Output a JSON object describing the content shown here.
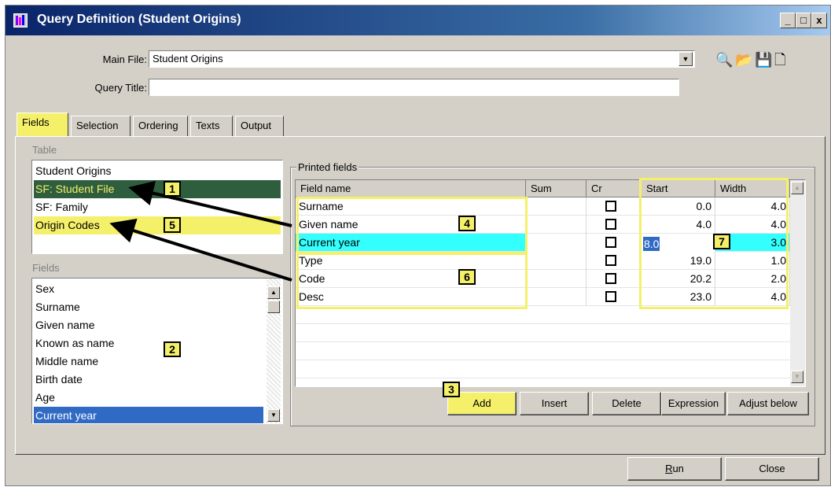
{
  "window": {
    "title": "Query Definition (Student Origins)",
    "minimize": "_",
    "maximize": "□",
    "close": "x"
  },
  "header": {
    "main_file_label": "Main File:",
    "main_file_value": "Student Origins",
    "query_title_label": "Query Title:",
    "query_title_value": "",
    "tools": [
      {
        "icon": "search-icon",
        "glyph": "🔍"
      },
      {
        "icon": "open-folder-icon",
        "glyph": "📂"
      },
      {
        "icon": "save-icon",
        "glyph": "💾"
      },
      {
        "icon": "new-document-icon",
        "glyph": "🗋"
      }
    ]
  },
  "tabs": [
    {
      "label": "Fields",
      "active": true
    },
    {
      "label": "Selection",
      "active": false
    },
    {
      "label": "Ordering",
      "active": false
    },
    {
      "label": "Texts",
      "active": false
    },
    {
      "label": "Output",
      "active": false
    }
  ],
  "table_group": {
    "label": "Table",
    "items": [
      "Student Origins",
      "SF: Student File",
      "SF: Family",
      "Origin Codes"
    ],
    "selected_index": 1,
    "highlighted_index": 3
  },
  "fields_group": {
    "label": "Fields",
    "items": [
      "Sex",
      "Surname",
      "Given name",
      "Known as name",
      "Middle name",
      "Birth date",
      "Age",
      "Current year"
    ],
    "selected_index": 7
  },
  "printed_fields": {
    "label": "Printed fields",
    "columns": [
      "Field name",
      "Sum",
      "Cr",
      "Start",
      "Width"
    ],
    "rows": [
      {
        "name": "Surname",
        "start": "0.0",
        "width": "4.0"
      },
      {
        "name": "Given name",
        "start": "4.0",
        "width": "4.0"
      },
      {
        "name": "Current year",
        "start": "8.0",
        "width": "3.0"
      },
      {
        "name": "Type",
        "start": "19.0",
        "width": "1.0"
      },
      {
        "name": "Code",
        "start": "20.2",
        "width": "2.0"
      },
      {
        "name": "Desc",
        "start": "23.0",
        "width": "4.0"
      }
    ],
    "selected_index": 2
  },
  "buttons": {
    "add": "Add",
    "insert": "Insert",
    "delete": "Delete",
    "expression": "Expression",
    "adjust_below": "Adjust below",
    "run": "Run",
    "close": "Close"
  },
  "markers": [
    "1",
    "2",
    "3",
    "4",
    "5",
    "6",
    "7"
  ],
  "colors": {
    "highlight": "#f5f06a",
    "selection_green": "#2e5e3e",
    "row_cyan": "#33ffff",
    "list_selection": "#316ac5",
    "title_blue": "#0a246a"
  }
}
